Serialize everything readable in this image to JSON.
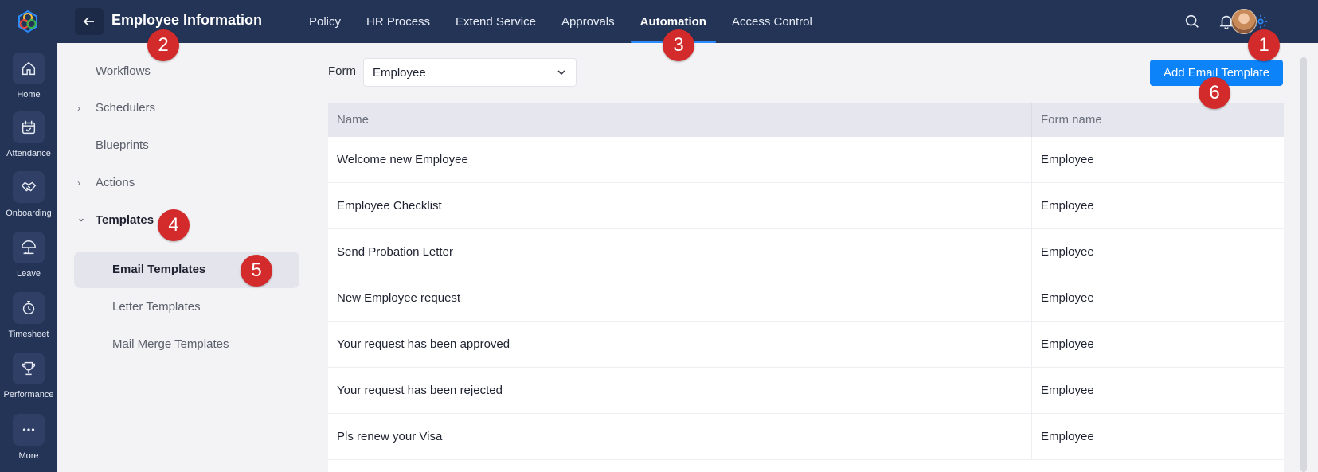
{
  "header": {
    "title": "Employee Information",
    "nav_tabs": [
      {
        "label": "Policy",
        "active": false
      },
      {
        "label": "HR Process",
        "active": false
      },
      {
        "label": "Extend Service",
        "active": false
      },
      {
        "label": "Approvals",
        "active": false
      },
      {
        "label": "Automation",
        "active": true
      },
      {
        "label": "Access Control",
        "active": false
      }
    ],
    "icons": [
      "search-icon",
      "bell-icon",
      "gear-icon"
    ],
    "accent_color": "#2a8cff"
  },
  "rail": {
    "items": [
      {
        "label": "Home",
        "icon": "home-icon"
      },
      {
        "label": "Attendance",
        "icon": "calendar-check-icon"
      },
      {
        "label": "Onboarding",
        "icon": "handshake-icon"
      },
      {
        "label": "Leave",
        "icon": "umbrella-icon"
      },
      {
        "label": "Timesheet",
        "icon": "stopwatch-icon"
      },
      {
        "label": "Performance",
        "icon": "trophy-icon"
      },
      {
        "label": "More",
        "icon": "more-dots-icon"
      }
    ]
  },
  "subnav": {
    "items": [
      {
        "label": "Workflows",
        "chevron": ""
      },
      {
        "label": "Schedulers",
        "chevron": "›"
      },
      {
        "label": "Blueprints",
        "chevron": ""
      },
      {
        "label": "Actions",
        "chevron": "›"
      },
      {
        "label": "Templates",
        "chevron": "⌄"
      }
    ],
    "children": [
      {
        "label": "Email Templates",
        "selected": true
      },
      {
        "label": "Letter Templates",
        "selected": false
      },
      {
        "label": "Mail Merge Templates",
        "selected": false
      }
    ]
  },
  "main": {
    "form_label": "Form",
    "form_value": "Employee",
    "add_button_label": "Add Email Template",
    "button_color": "#0d83fa",
    "table": {
      "columns": [
        "Name",
        "Form name",
        ""
      ],
      "rows": [
        [
          "Welcome new Employee",
          "Employee"
        ],
        [
          "Employee Checklist",
          "Employee"
        ],
        [
          "Send Probation Letter",
          "Employee"
        ],
        [
          "New Employee request",
          "Employee"
        ],
        [
          "Your request has been approved",
          "Employee"
        ],
        [
          "Your request has been rejected",
          "Employee"
        ],
        [
          "Pls renew your Visa",
          "Employee"
        ]
      ]
    }
  },
  "callouts": [
    "1",
    "2",
    "3",
    "4",
    "5",
    "6"
  ]
}
